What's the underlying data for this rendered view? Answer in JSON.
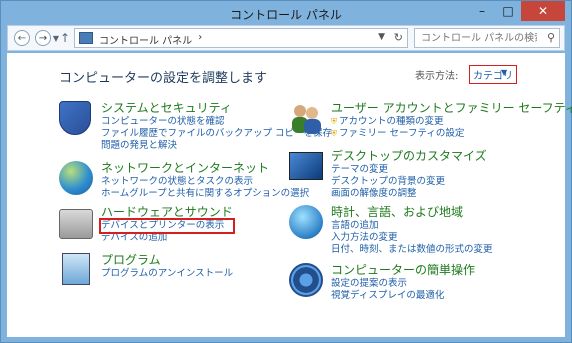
{
  "window": {
    "title": "コントロール パネル"
  },
  "nav": {
    "breadcrumb": [
      "コントロール パネル",
      "›"
    ],
    "search_placeholder": "コントロール パネルの検索"
  },
  "header": {
    "title": "コンピューターの設定を調整します",
    "viewby_label": "表示方法:",
    "viewby_value": "カテゴリ"
  },
  "categories": [
    {
      "title": "システムとセキュリティ",
      "links": [
        "コンピューターの状態を確認",
        "ファイル履歴でファイルのバックアップ コピーを保存",
        "問題の発見と解決"
      ],
      "icon": "security-shield-icon"
    },
    {
      "title": "ネットワークとインターネット",
      "links": [
        "ネットワークの状態とタスクの表示",
        "ホームグループと共有に関するオプションの選択"
      ],
      "icon": "network-globe-icon"
    },
    {
      "title": "ハードウェアとサウンド",
      "links": [
        "デバイスとプリンターの表示",
        "デバイスの追加"
      ],
      "icon": "printer-icon"
    },
    {
      "title": "プログラム",
      "links": [
        "プログラムのアンインストール"
      ],
      "icon": "programs-icon"
    },
    {
      "title": "ユーザー アカウントとファミリー セーフティ",
      "links": [
        "アカウントの種類の変更",
        "ファミリー セーフティの設定"
      ],
      "icon": "users-icon"
    },
    {
      "title": "デスクトップのカスタマイズ",
      "links": [
        "テーマの変更",
        "デスクトップの背景の変更",
        "画面の解像度の調整"
      ],
      "icon": "desktop-icon"
    },
    {
      "title": "時計、言語、および地域",
      "links": [
        "言語の追加",
        "入力方法の変更",
        "日付、時刻、または数値の形式の変更"
      ],
      "icon": "clock-globe-icon"
    },
    {
      "title": "コンピューターの簡単操作",
      "links": [
        "設定の提案の表示",
        "視覚ディスプレイの最適化"
      ],
      "icon": "accessibility-icon"
    }
  ]
}
